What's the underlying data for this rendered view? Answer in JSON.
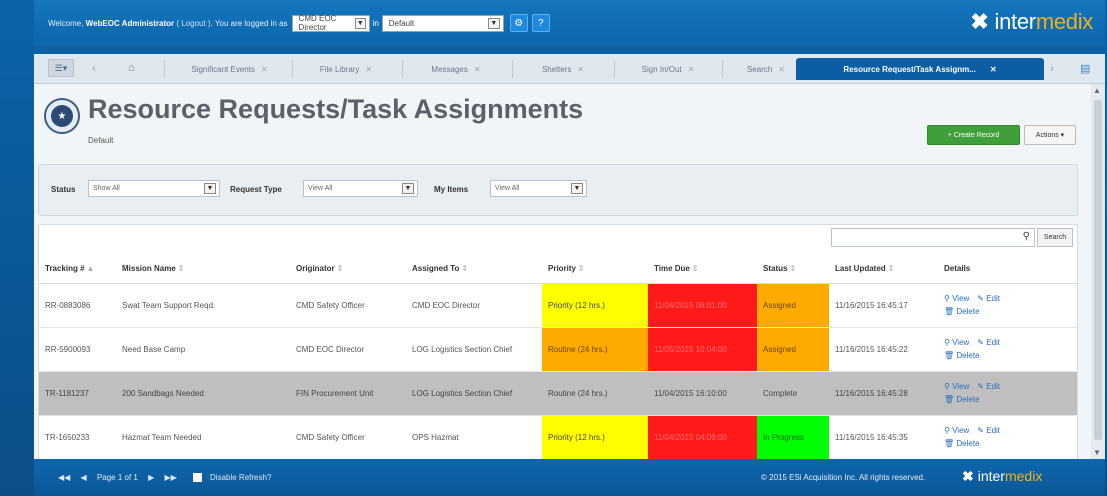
{
  "topbar": {
    "welcome_prefix": "Welcome,",
    "user": "WebEOC Administrator",
    "logout": "( Logout )",
    "logged_in_as": ". You are logged in as",
    "position": "CMD EOC Director",
    "in": "in",
    "incident": "Default",
    "brand_mark": "✖",
    "brand_a": "inter",
    "brand_b": "medix"
  },
  "tabs": {
    "items": [
      {
        "label": "Significant Events"
      },
      {
        "label": "File Library"
      },
      {
        "label": "Messages"
      },
      {
        "label": "Shelters"
      },
      {
        "label": "Sign In/Out"
      },
      {
        "label": "Search"
      },
      {
        "label": "Resource Request/Task Assignm..."
      }
    ],
    "close_glyph": "✕"
  },
  "page": {
    "title": "Resource Requests/Task Assignments",
    "subtitle": "Default",
    "create_label": "+ Create Record",
    "actions_label": "Actions ▾"
  },
  "filters": {
    "status_label": "Status",
    "status_value": "Show All",
    "request_type_label": "Request Type",
    "request_type_value": "View All",
    "my_items_label": "My Items",
    "my_items_value": "View All"
  },
  "grid": {
    "search_placeholder": "",
    "search_label": "Search",
    "columns": [
      "Tracking #",
      "Mission Name",
      "Originator",
      "Assigned To",
      "Priority",
      "Time Due",
      "Status",
      "Last Updated",
      "Details"
    ],
    "sort_asc": "▲",
    "sort_both": "⇕",
    "view_label": "View",
    "edit_label": "Edit",
    "delete_label": "Delete",
    "rows": [
      {
        "tracking": "RR-0883086",
        "mission": "Swat Team Support Reqd.",
        "originator": "CMD Safety Officer",
        "assigned": "CMD EOC Director",
        "priority": "Priority (12 hrs.)",
        "due": "11/04/2015 06:01:00",
        "status": "Assigned",
        "updated": "11/16/2015 16:45:17"
      },
      {
        "tracking": "RR-5900093",
        "mission": "Need Base Camp",
        "originator": "CMD EOC Director",
        "assigned": "LOG Logistics Section Chief",
        "priority": "Routine (24 hrs.)",
        "due": "11/05/2015 10:04:00",
        "status": "Assigned",
        "updated": "11/16/2015 16:45:22"
      },
      {
        "tracking": "TR-1181237",
        "mission": "200 Sandbags Needed",
        "originator": "FIN Procurement Unit",
        "assigned": "LOG Logistics Section Chief",
        "priority": "Routine (24 hrs.)",
        "due": "11/04/2015 16:10:00",
        "status": "Complete",
        "updated": "11/16/2015 16:45:28"
      },
      {
        "tracking": "TR-1650233",
        "mission": "Hazmat Team Needed",
        "originator": "CMD Safety Officer",
        "assigned": "OPS Hazmat",
        "priority": "Priority (12 hrs.)",
        "due": "11/04/2015 04:09:00",
        "status": "In Progress",
        "updated": "11/16/2015 16:45:35"
      }
    ]
  },
  "footer": {
    "first": "◀◀",
    "prev": "◀",
    "page_text": "Page 1 of 1",
    "next": "▶",
    "last": "▶▶",
    "disable_refresh": "Disable Refresh?",
    "copyright": "© 2015 ESi Acquisition Inc. All rights reserved.",
    "brand_mark": "✖",
    "brand_a": "inter",
    "brand_b": "medix"
  },
  "colors": {
    "priority_yellow": "#ffff00",
    "due_red": "#ff1a1a",
    "status_assigned": "#ffaa00",
    "status_in_progress": "#00ff00",
    "row_complete": "#bfbfbf"
  }
}
